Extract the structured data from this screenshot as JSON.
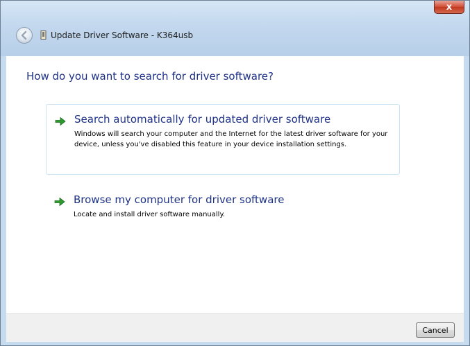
{
  "window": {
    "title": "Update Driver Software - K364usb",
    "close_glyph": "x"
  },
  "main": {
    "heading": "How do you want to search for driver software?",
    "options": [
      {
        "title": "Search automatically for updated driver software",
        "description": "Windows will search your computer and the Internet for the latest driver software for your device, unless you've disabled this feature in your device installation settings.",
        "icon": "green-arrow-icon"
      },
      {
        "title": "Browse my computer for driver software",
        "description": "Locate and install driver software manually.",
        "icon": "green-arrow-icon"
      }
    ]
  },
  "footer": {
    "cancel_label": "Cancel"
  },
  "colors": {
    "accent_text": "#1e3287",
    "arrow_green": "#2f9a2f",
    "close_red": "#c0371f"
  }
}
